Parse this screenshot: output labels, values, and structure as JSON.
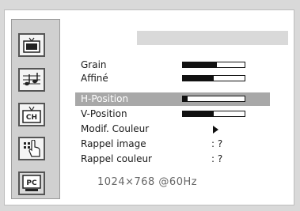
{
  "menu": {
    "icons": [
      {
        "name": "picture-icon"
      },
      {
        "name": "sound-icon"
      },
      {
        "name": "channel-icon",
        "label": "CH"
      },
      {
        "name": "setup-icon"
      },
      {
        "name": "pc-icon",
        "label": "PC",
        "active": true
      }
    ]
  },
  "settings": {
    "items": [
      {
        "label": "Grain",
        "type": "bar",
        "value_percent": 0.55
      },
      {
        "label": "Affiné",
        "type": "bar",
        "value_percent": 0.5
      },
      {
        "label": "H-Position",
        "type": "bar",
        "value_percent": 0.08,
        "selected": true
      },
      {
        "label": "V-Position",
        "type": "bar",
        "value_percent": 0.5
      },
      {
        "label": "Modif. Couleur",
        "type": "arrow"
      },
      {
        "label": "Rappel image",
        "type": "text",
        "value": ": ?"
      },
      {
        "label": "Rappel couleur",
        "type": "text",
        "value": ": ?"
      }
    ]
  },
  "resolution": "1024×768  @60Hz",
  "colors": {
    "background": "#d9d9d9",
    "panel": "#ffffff",
    "highlight": "#a8a8a8",
    "bar_fill": "#111111"
  }
}
